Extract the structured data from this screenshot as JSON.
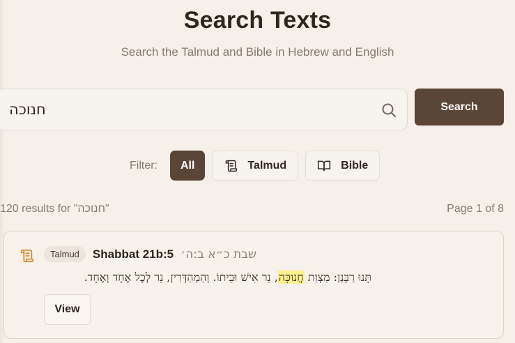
{
  "header": {
    "title": "Search Texts",
    "subtitle": "Search the Talmud and Bible in Hebrew and English"
  },
  "search": {
    "value": "חנוכה",
    "button_label": "Search",
    "icon": "search-icon"
  },
  "filters": {
    "label": "Filter:",
    "options": [
      {
        "label": "All",
        "active": true
      },
      {
        "label": "Talmud",
        "icon": "scroll-icon",
        "active": false
      },
      {
        "label": "Bible",
        "icon": "book-open-icon",
        "active": false
      }
    ]
  },
  "results": {
    "count_text": "120 results for \"חנוכה\"",
    "page_text": "Page 1 of 8",
    "items": [
      {
        "icon": "scroll-icon",
        "badge": "Talmud",
        "reference": "Shabbat 21b:5",
        "hebrew_reference": "שבת כ״א ב:ה׳",
        "snippet_before": "תָּנוּ רַבָּנַן: מִצְוַת ",
        "snippet_highlight": "חֲנוּכָּה",
        "snippet_after": ", נֵר אִישׁ וּבֵיתוֹ. וְהַמְהַדְּרִין, נֵר לְכׇל אֶחָד וְאֶחָד.",
        "view_label": "View"
      }
    ]
  },
  "colors": {
    "background": "#f5f0ea",
    "accent": "#5a4536",
    "highlight": "#fdf18d",
    "icon_orange": "#d98a2b"
  }
}
